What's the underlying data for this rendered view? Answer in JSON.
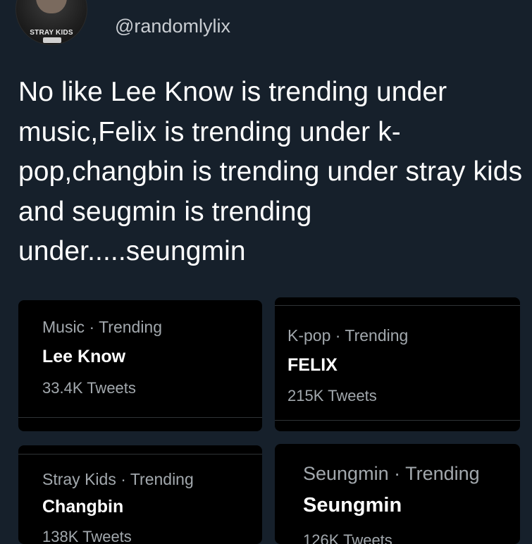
{
  "author": {
    "handle": "@randomlylix",
    "avatar_logo_text": "STRAY KIDS"
  },
  "tweet": {
    "text": "No like Lee Know is trending under music,Felix is trending under k-pop,changbin is trending under stray kids and seugmin is trending under.....seungmin"
  },
  "trends": [
    {
      "context": "Music · Trending",
      "name": "Lee Know",
      "tweets": "33.4K Tweets"
    },
    {
      "context": "K-pop · Trending",
      "name": "FELIX",
      "tweets": "215K Tweets"
    },
    {
      "context": "Stray Kids · Trending",
      "name": "Changbin",
      "tweets": "138K Tweets"
    },
    {
      "context": "Seungmin · Trending",
      "name": "Seungmin",
      "tweets": "126K Tweets"
    }
  ],
  "colors": {
    "background": "#16202b",
    "card": "#000000",
    "text_primary": "#ffffff",
    "text_secondary": "#a2a8ad"
  }
}
